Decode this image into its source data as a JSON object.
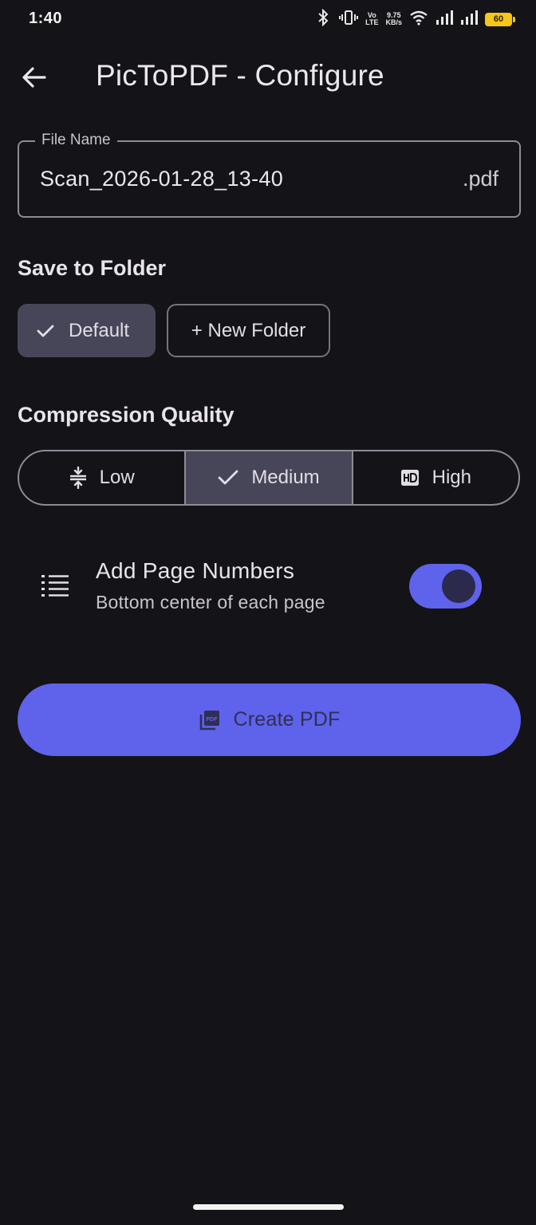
{
  "status_bar": {
    "time": "1:40",
    "network_label_1": "VoLTE1",
    "network_label_1_display": [
      "Vo",
      "LTE"
    ],
    "speed_value": "9.75",
    "speed_unit": "KB/s",
    "battery_level": "60",
    "battery_color": "#f5c518"
  },
  "app_bar": {
    "title": "PicToPDF - Configure",
    "back_icon": "arrow-back-icon"
  },
  "file_name": {
    "label": "File Name",
    "value": "Scan_2026-01-28_13-40",
    "suffix": ".pdf"
  },
  "save_folder": {
    "title": "Save to Folder",
    "chips": [
      {
        "label": "Default",
        "selected": true,
        "icon": "check-icon"
      },
      {
        "label": "+ New Folder",
        "selected": false
      }
    ]
  },
  "compression": {
    "title": "Compression Quality",
    "options": [
      {
        "label": "Low",
        "icon": "compress-icon",
        "selected": false
      },
      {
        "label": "Medium",
        "icon": "check-icon",
        "selected": true
      },
      {
        "label": "High",
        "icon": "hd-icon",
        "selected": false
      }
    ]
  },
  "page_numbers": {
    "title": "Add Page Numbers",
    "subtitle": "Bottom center of each page",
    "icon": "list-numbered-icon",
    "enabled": true
  },
  "create_button": {
    "label": "Create PDF",
    "icon": "picture-as-pdf-icon"
  },
  "colors": {
    "background": "#141317",
    "accent": "#5f62ea",
    "selected_surface": "#474659",
    "outline": "#8f8a96"
  }
}
